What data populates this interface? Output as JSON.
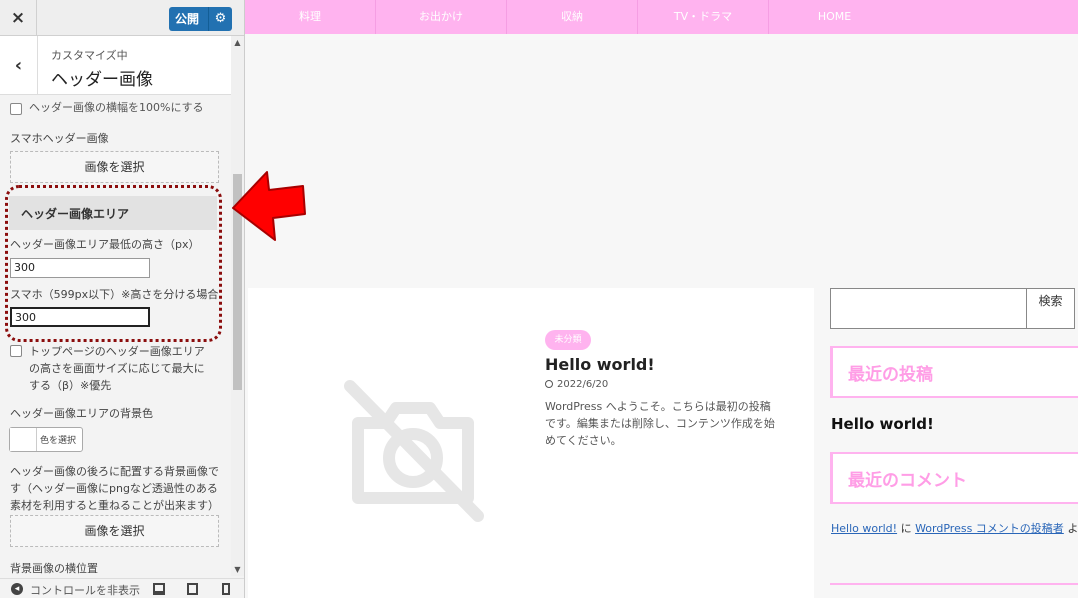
{
  "panel": {
    "close_icon": "×",
    "publish_label": "公開",
    "publish_gear_icon": "gear-icon",
    "back_icon": "‹",
    "breadcrumb": "カスタマイズ中",
    "section_title": "ヘッダー画像",
    "full_width_checkbox_label": "ヘッダー画像の横幅を100%にする",
    "sp_header_label": "スマホヘッダー画像",
    "select_image_label": "画像を選択",
    "area_section_title": "ヘッダー画像エリア",
    "min_height_label": "ヘッダー画像エリア最低の高さ（px）",
    "min_height_value": "300",
    "sp_height_label": "スマホ（599px以下）※高さを分ける場合",
    "sp_height_value": "300",
    "fullscreen_checkbox_label": "トップページのヘッダー画像エリアの高さを画面サイズに応じて最大にする（β）※優先",
    "bg_color_label": "ヘッダー画像エリアの背景色",
    "color_button_label": "色を選択",
    "bg_image_description": "ヘッダー画像の後ろに配置する背景画像です（ヘッダー画像にpngなど透過性のある素材を利用すると重ねることが出来ます）",
    "select_image_label_2": "画像を選択",
    "bg_position_label": "背景画像の横位置",
    "hide_controls_label": "コントロールを非表示"
  },
  "preview": {
    "nav_items": [
      "料理",
      "お出かけ",
      "収納",
      "TV・ドラマ",
      "HOME"
    ],
    "post": {
      "category_badge": "未分類",
      "title": "Hello world!",
      "date": "2022/6/20",
      "excerpt": "WordPress へようこそ。こちらは最初の投稿です。編集または削除し、コンテンツ作成を始めてください。"
    },
    "sidebar": {
      "search_button": "検索",
      "recent_posts_title": "最近の投稿",
      "recent_post_link": "Hello world!",
      "recent_comments_title": "最近のコメント",
      "comment_post_link": "Hello world!",
      "comment_joiner": "に",
      "comment_author_link": "WordPress コメントの投稿者",
      "comment_suffix": "より"
    }
  },
  "colors": {
    "accent_pink": "#ffb3ef",
    "publish_blue": "#2271b1",
    "highlight_border": "#8b0d0d",
    "arrow_red": "#ff0000"
  }
}
